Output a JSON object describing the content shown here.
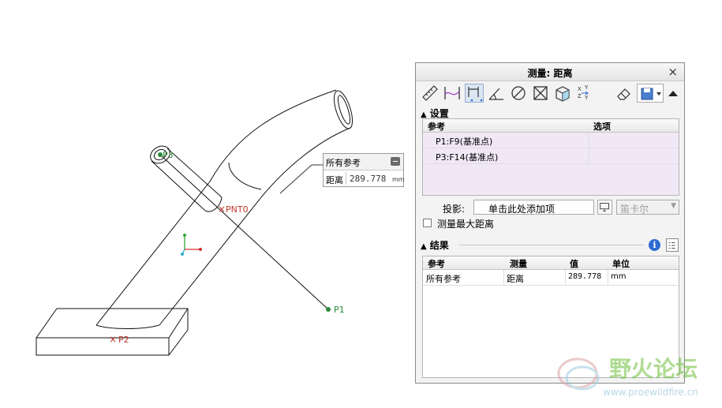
{
  "viewport": {
    "point_labels": {
      "p1": "P1",
      "p2": "P2",
      "p3": "P3",
      "pnt0": "PNT0"
    },
    "callout": {
      "title": "所有参考",
      "label": "距离",
      "value": "289.778",
      "unit": "mm"
    }
  },
  "panel": {
    "title": "测量: 距离",
    "close_label": "×",
    "toolbar": {
      "tools": [
        "length-tool-icon",
        "curve-tool-icon",
        "distance-tool-icon",
        "angle-tool-icon",
        "diameter-tool-icon",
        "area-tool-icon",
        "volume-tool-icon",
        "transform-tool-icon"
      ],
      "eraser": "eraser-icon",
      "save": "save-icon"
    },
    "settings": {
      "header": "设置",
      "columns": [
        "参考",
        "选项"
      ],
      "rows": [
        "P1:F9(基准点)",
        "P3:F14(基准点)"
      ],
      "projection_label": "投影:",
      "projection_placeholder": "单击此处添加项",
      "coord_select": "笛卡尔",
      "max_distance_label": "测量最大距离",
      "max_distance_checked": false
    },
    "results": {
      "header": "结果",
      "columns": [
        "参考",
        "测量",
        "值",
        "单位"
      ],
      "rows": [
        {
          "ref": "所有参考",
          "measure": "距离",
          "value": "289.778",
          "unit": "mm"
        }
      ]
    }
  },
  "watermark": {
    "text": "野火论坛",
    "url": "www.proewildfire.cn"
  },
  "colors": {
    "accent": "#2d6bd0",
    "selection_fill": "#f0e8f6",
    "point_green": "#2a8a3a",
    "watermark": "#6cbf3a"
  }
}
